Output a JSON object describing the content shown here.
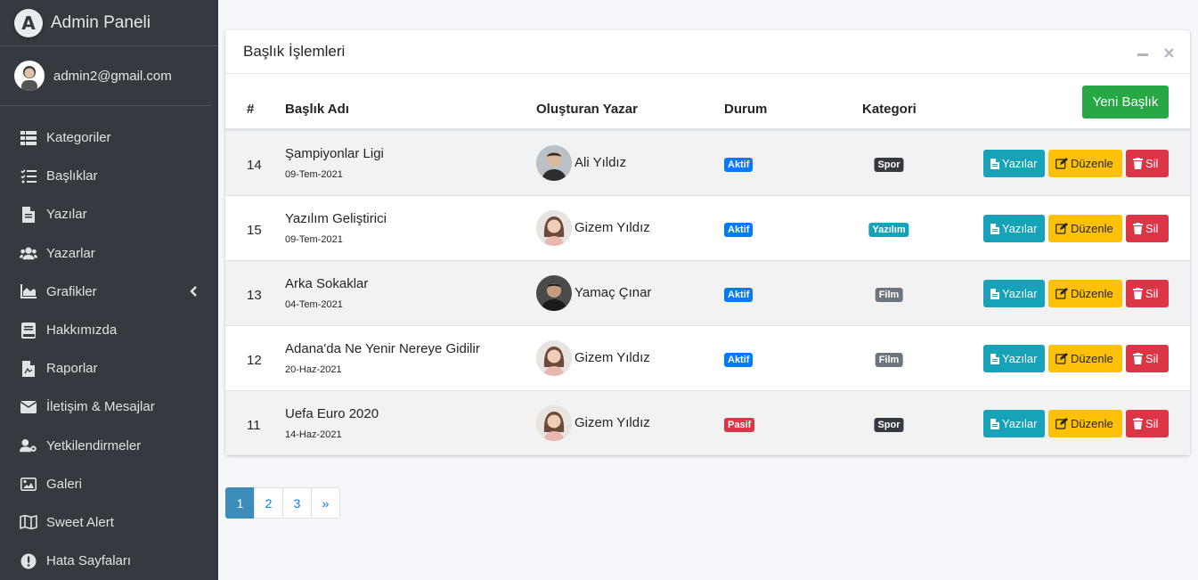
{
  "brand": {
    "title": "Admin Paneli",
    "logo_letter": "A"
  },
  "user": {
    "email": "admin2@gmail.com"
  },
  "nav": [
    {
      "label": "Kategoriler",
      "icon": "table-icon"
    },
    {
      "label": "Başlıklar",
      "icon": "list-check-icon"
    },
    {
      "label": "Yazılar",
      "icon": "file-icon"
    },
    {
      "label": "Yazarlar",
      "icon": "users-icon"
    },
    {
      "label": "Grafikler",
      "icon": "chart-area-icon"
    },
    {
      "label": "Hakkımızda",
      "icon": "book-icon"
    },
    {
      "label": "Raporlar",
      "icon": "file-pdf-icon"
    },
    {
      "label": "İletişim & Mesajlar",
      "icon": "envelope-icon"
    },
    {
      "label": "Yetkilendirmeler",
      "icon": "user-cog-icon"
    },
    {
      "label": "Galeri",
      "icon": "image-icon"
    },
    {
      "label": "Sweet Alert",
      "icon": "map-icon"
    },
    {
      "label": "Hata Sayfaları",
      "icon": "error-icon"
    }
  ],
  "card": {
    "title": "Başlık İşlemleri",
    "new_button": "Yeni Başlık"
  },
  "table": {
    "headers": {
      "id": "#",
      "title": "Başlık Adı",
      "author": "Oluşturan Yazar",
      "status": "Durum",
      "category": "Kategori"
    },
    "rows": [
      {
        "id": "14",
        "title": "Şampiyonlar Ligi",
        "date": "09-Tem-2021",
        "author": "Ali Yıldız",
        "status": "Aktif",
        "category": "Spor"
      },
      {
        "id": "15",
        "title": "Yazılım Geliştirici",
        "date": "09-Tem-2021",
        "author": "Gizem Yıldız",
        "status": "Aktif",
        "category": "Yazılım"
      },
      {
        "id": "13",
        "title": "Arka Sokaklar",
        "date": "04-Tem-2021",
        "author": "Yamaç Çınar",
        "status": "Aktif",
        "category": "Film"
      },
      {
        "id": "12",
        "title": "Adana'da Ne Yenir Nereye Gidilir",
        "date": "20-Haz-2021",
        "author": "Gizem Yıldız",
        "status": "Aktif",
        "category": "Film"
      },
      {
        "id": "11",
        "title": "Uefa Euro 2020",
        "date": "14-Haz-2021",
        "author": "Gizem Yıldız",
        "status": "Pasif",
        "category": "Spor"
      }
    ],
    "actions": {
      "posts": "Yazılar",
      "edit": "Düzenle",
      "delete": "Sil"
    }
  },
  "pagination": {
    "pages": [
      "1",
      "2",
      "3"
    ],
    "next": "»",
    "current": "1"
  },
  "colors": {
    "status_active": "#007bff",
    "status_passive": "#dc3545",
    "cat_spor": "#343a40",
    "cat_yazilim": "#17a2b8",
    "cat_film": "#6c757d"
  }
}
